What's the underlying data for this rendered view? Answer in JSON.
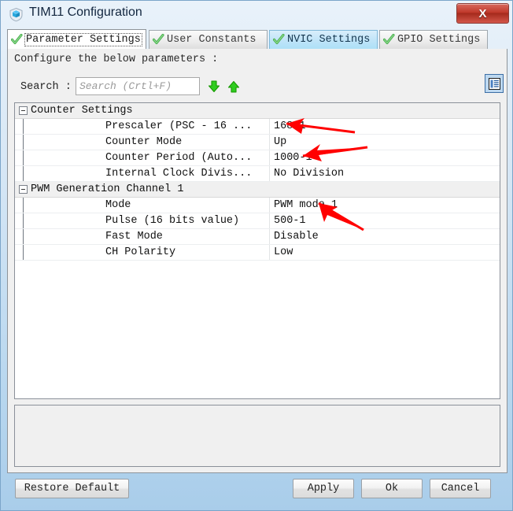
{
  "window": {
    "title": "TIM11 Configuration",
    "title_icon": "shield-icon",
    "close_label": "X",
    "accent_red": "#c0392b",
    "accent_blue": "#3c6ea5"
  },
  "tabs": [
    {
      "label": "Parameter Settings",
      "state": "active",
      "icon": "green-check-icon"
    },
    {
      "label": "User Constants",
      "state": "normal",
      "icon": "green-check-icon"
    },
    {
      "label": "NVIC Settings",
      "state": "hover",
      "icon": "green-check-icon"
    },
    {
      "label": "GPIO Settings",
      "state": "normal",
      "icon": "green-check-icon"
    }
  ],
  "panel": {
    "instruction": "Configure the below parameters :"
  },
  "search": {
    "label": "Search :",
    "value": "",
    "placeholder": "Search (Crtl+F)",
    "next_icon": "arrow-down-icon",
    "prev_icon": "arrow-up-icon",
    "view_toggle_icon": "list-view-icon"
  },
  "tree": {
    "groups": [
      {
        "title": "Counter Settings",
        "expanded": true,
        "rows": [
          {
            "name": "Prescaler (PSC - 16 ...",
            "value": "168-1"
          },
          {
            "name": "Counter Mode",
            "value": "Up"
          },
          {
            "name": "Counter Period (Auto...",
            "value": "1000-1"
          },
          {
            "name": "Internal Clock Divis...",
            "value": "No Division"
          }
        ]
      },
      {
        "title": "PWM Generation Channel 1",
        "expanded": true,
        "rows": [
          {
            "name": "Mode",
            "value": "PWM mode 1"
          },
          {
            "name": "Pulse (16 bits value)",
            "value": "500-1"
          },
          {
            "name": "Fast Mode",
            "value": "Disable"
          },
          {
            "name": "CH Polarity",
            "value": "Low"
          }
        ]
      }
    ]
  },
  "footer": {
    "restore_label": "Restore Default",
    "apply_label": "Apply",
    "ok_label": "Ok",
    "cancel_label": "Cancel"
  },
  "annotations": {
    "color": "#ff0000",
    "arrows": [
      {
        "target": "prescaler-value"
      },
      {
        "target": "counter-period-value"
      },
      {
        "target": "pwm-mode-value"
      }
    ]
  }
}
